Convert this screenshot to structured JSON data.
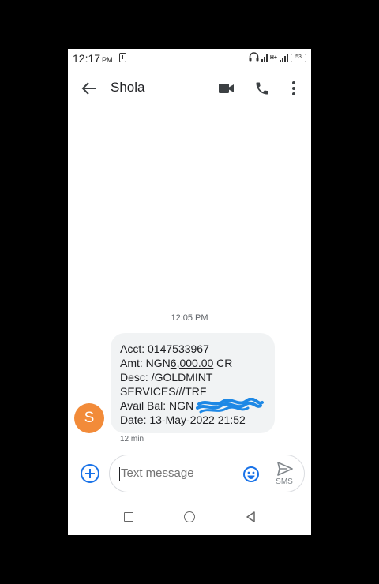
{
  "status_bar": {
    "time": "12:17",
    "ampm": "PM",
    "battery": "53",
    "network": "H+"
  },
  "header": {
    "contact_name": "Shola"
  },
  "conversation": {
    "timestamp": "12:05 PM",
    "avatar_initial": "S",
    "avatar_color": "#f28b39",
    "message": {
      "acct_label": "Acct: ",
      "acct_value": "0147533967",
      "amt_label": "Amt: NGN",
      "amt_value": "6,000.00",
      "amt_suffix": " CR",
      "desc_line1": "Desc: /GOLDMINT",
      "desc_line2": "SERVICES///TRF",
      "bal_label": "Avail Bal: NGN",
      "date_label": "Date: 13-May-",
      "date_value": "2022 21",
      "date_suffix": ":52"
    },
    "message_time": "12 min"
  },
  "compose": {
    "placeholder": "Text message",
    "send_label": "SMS"
  },
  "colors": {
    "accent": "#1a73e8",
    "bubble": "#f1f3f4",
    "scribble": "#1e88e5"
  }
}
